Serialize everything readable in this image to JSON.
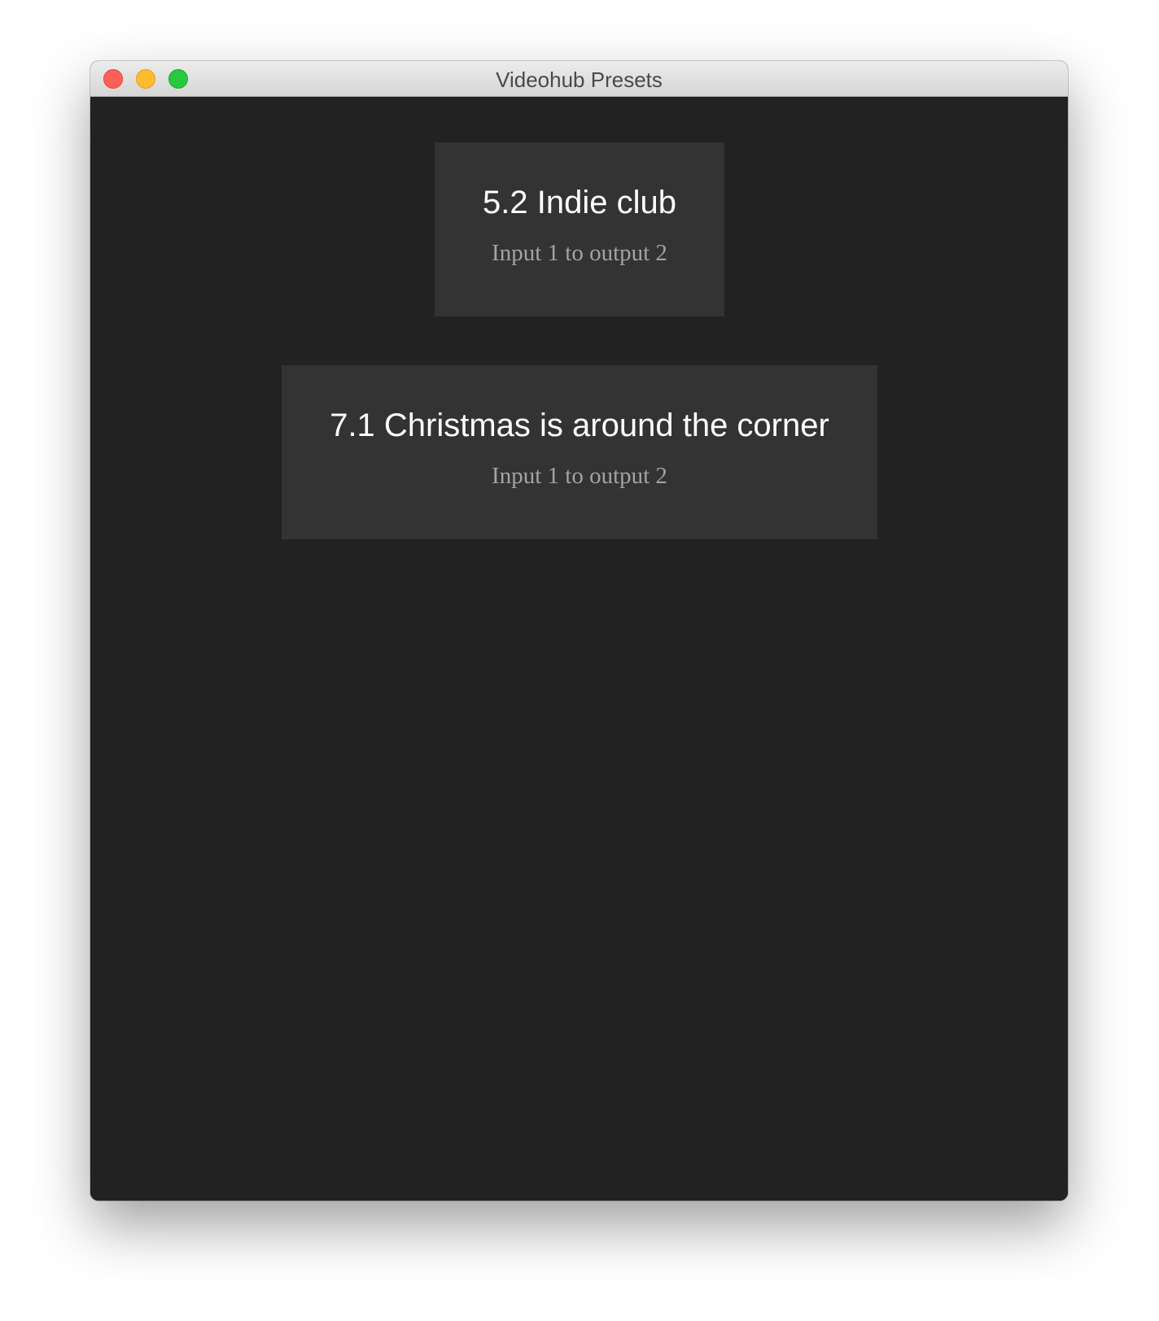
{
  "window": {
    "title": "Videohub Presets"
  },
  "presets": [
    {
      "name": "5.2 Indie club",
      "route": "Input 1 to output 2"
    },
    {
      "name": "7.1 Christmas is around the corner",
      "route": "Input 1 to output 2"
    }
  ],
  "colors": {
    "background": "#222222",
    "card": "#333333",
    "name_text": "#ffffff",
    "route_text": "#a3a3a3",
    "close": "#fe5f57",
    "minimize": "#febc2e",
    "zoom": "#28c840"
  },
  "icons": {
    "close": "close-icon",
    "minimize": "minimize-icon",
    "zoom": "zoom-icon"
  }
}
